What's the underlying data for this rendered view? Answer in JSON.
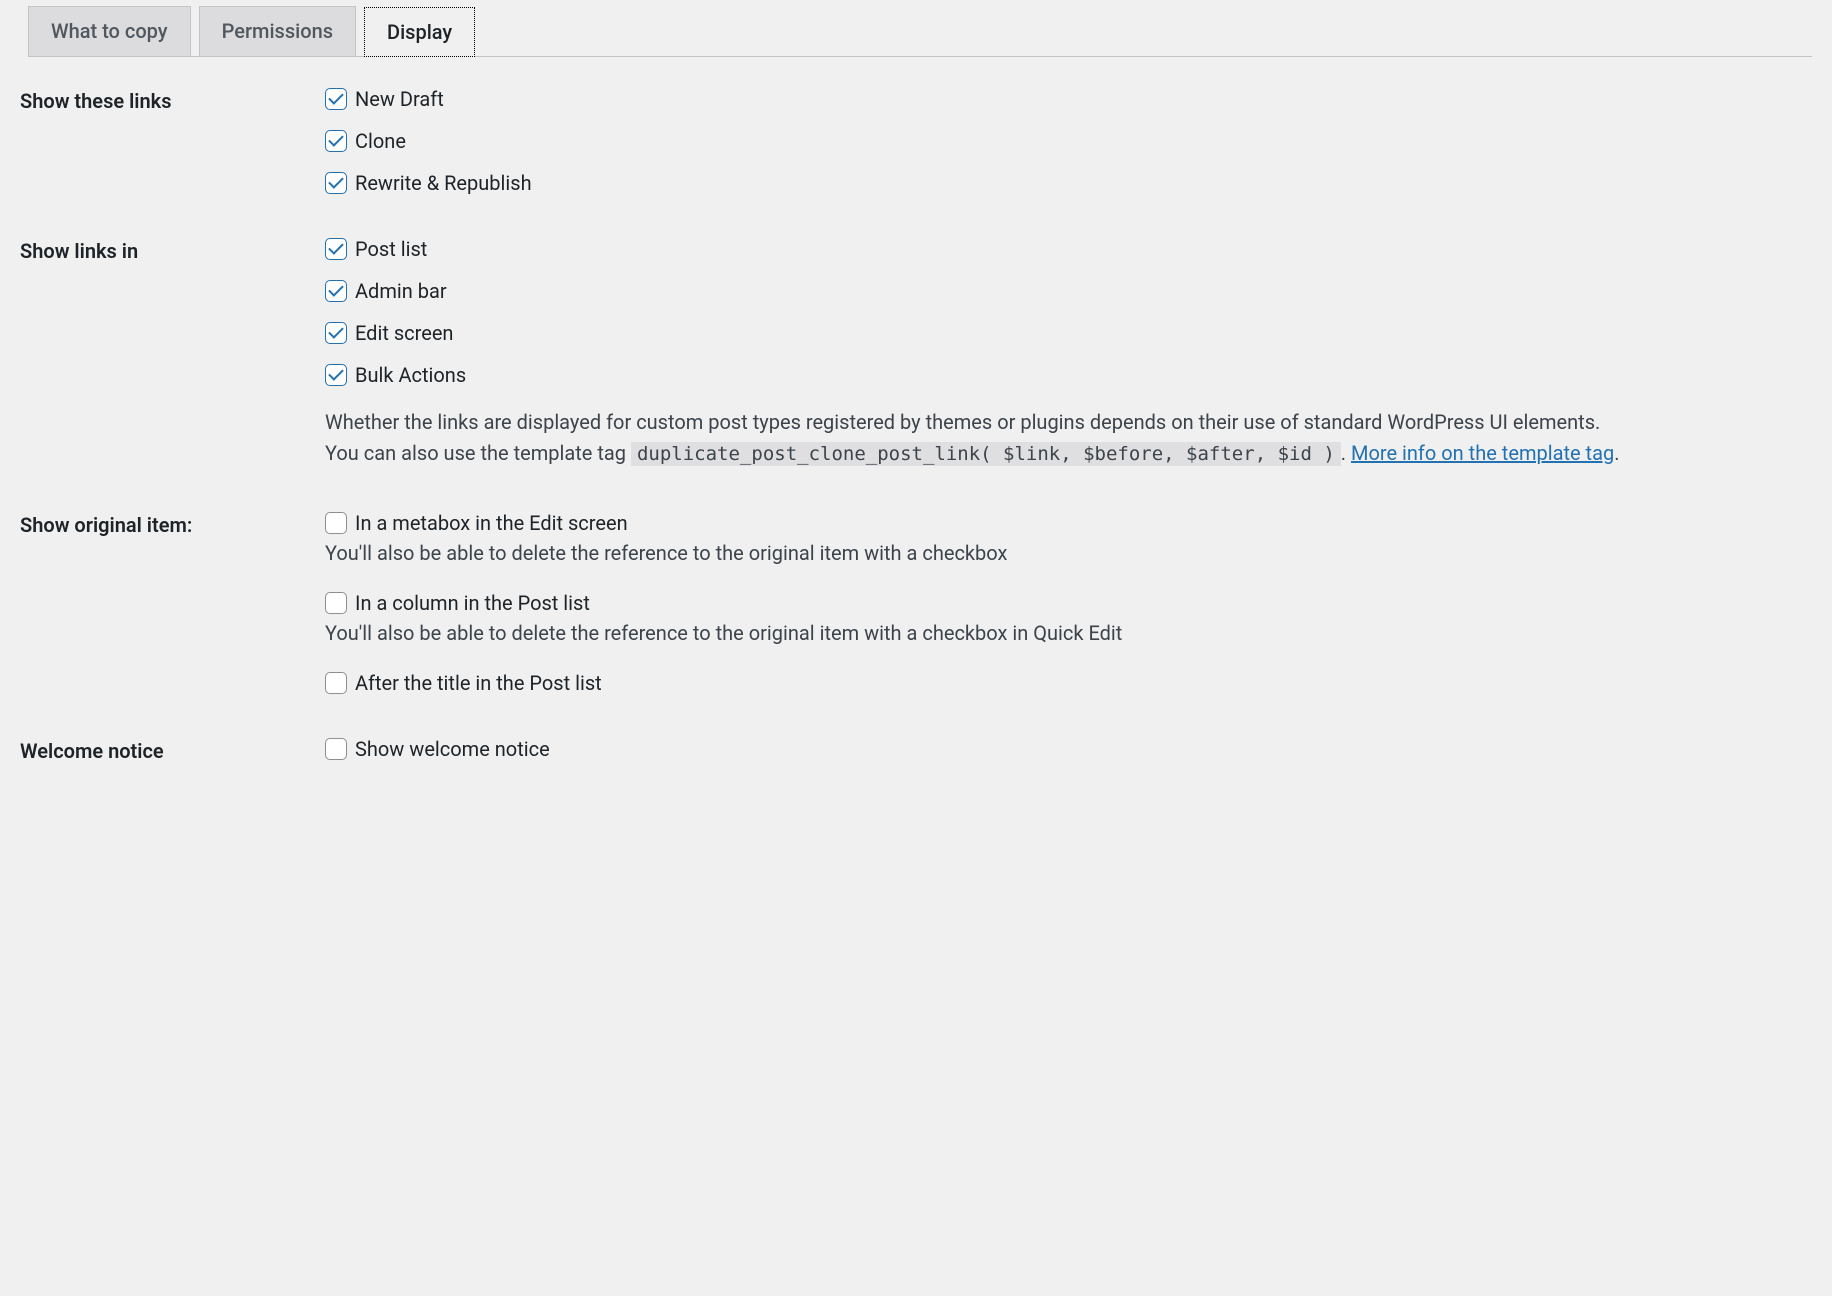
{
  "tabs": [
    {
      "label": "What to copy",
      "active": false
    },
    {
      "label": "Permissions",
      "active": false
    },
    {
      "label": "Display",
      "active": true
    }
  ],
  "sections": {
    "show_links": {
      "heading": "Show these links",
      "items": [
        {
          "label": "New Draft",
          "checked": true
        },
        {
          "label": "Clone",
          "checked": true
        },
        {
          "label": "Rewrite & Republish",
          "checked": true
        }
      ]
    },
    "show_links_in": {
      "heading": "Show links in",
      "items": [
        {
          "label": "Post list",
          "checked": true
        },
        {
          "label": "Admin bar",
          "checked": true
        },
        {
          "label": "Edit screen",
          "checked": true
        },
        {
          "label": "Bulk Actions",
          "checked": true
        }
      ],
      "desc_line1": "Whether the links are displayed for custom post types registered by themes or plugins depends on their use of standard WordPress UI elements.",
      "desc_line2_pre": "You can also use the template tag ",
      "desc_code": "duplicate_post_clone_post_link( $link, $before, $after, $id )",
      "desc_line2_mid": ". ",
      "desc_link": "More info on the template tag",
      "desc_line2_post": "."
    },
    "show_original": {
      "heading": "Show original item:",
      "items": [
        {
          "label": "In a metabox in the Edit screen",
          "checked": false,
          "sub": "You'll also be able to delete the reference to the original item with a checkbox"
        },
        {
          "label": "In a column in the Post list",
          "checked": false,
          "sub": "You'll also be able to delete the reference to the original item with a checkbox in Quick Edit"
        },
        {
          "label": "After the title in the Post list",
          "checked": false,
          "sub": ""
        }
      ]
    },
    "welcome": {
      "heading": "Welcome notice",
      "items": [
        {
          "label": "Show welcome notice",
          "checked": false
        }
      ]
    }
  }
}
